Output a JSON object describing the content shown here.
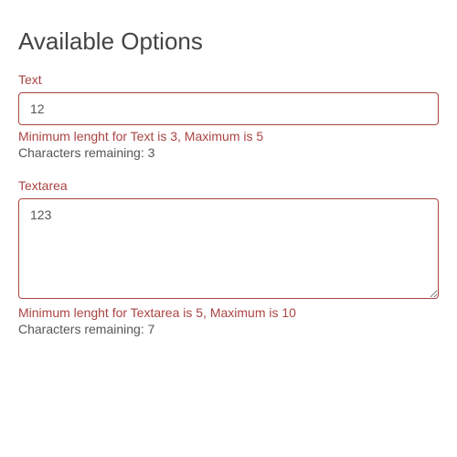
{
  "section": {
    "title": "Available Options"
  },
  "fields": {
    "text": {
      "label": "Text",
      "value": "12",
      "error": "Minimum lenght for Text is 3, Maximum is 5",
      "remaining": "Characters remaining: 3"
    },
    "textarea": {
      "label": "Textarea",
      "value": "123",
      "error": "Minimum lenght for Textarea is 5, Maximum is 10",
      "remaining": "Characters remaining: 7"
    }
  }
}
